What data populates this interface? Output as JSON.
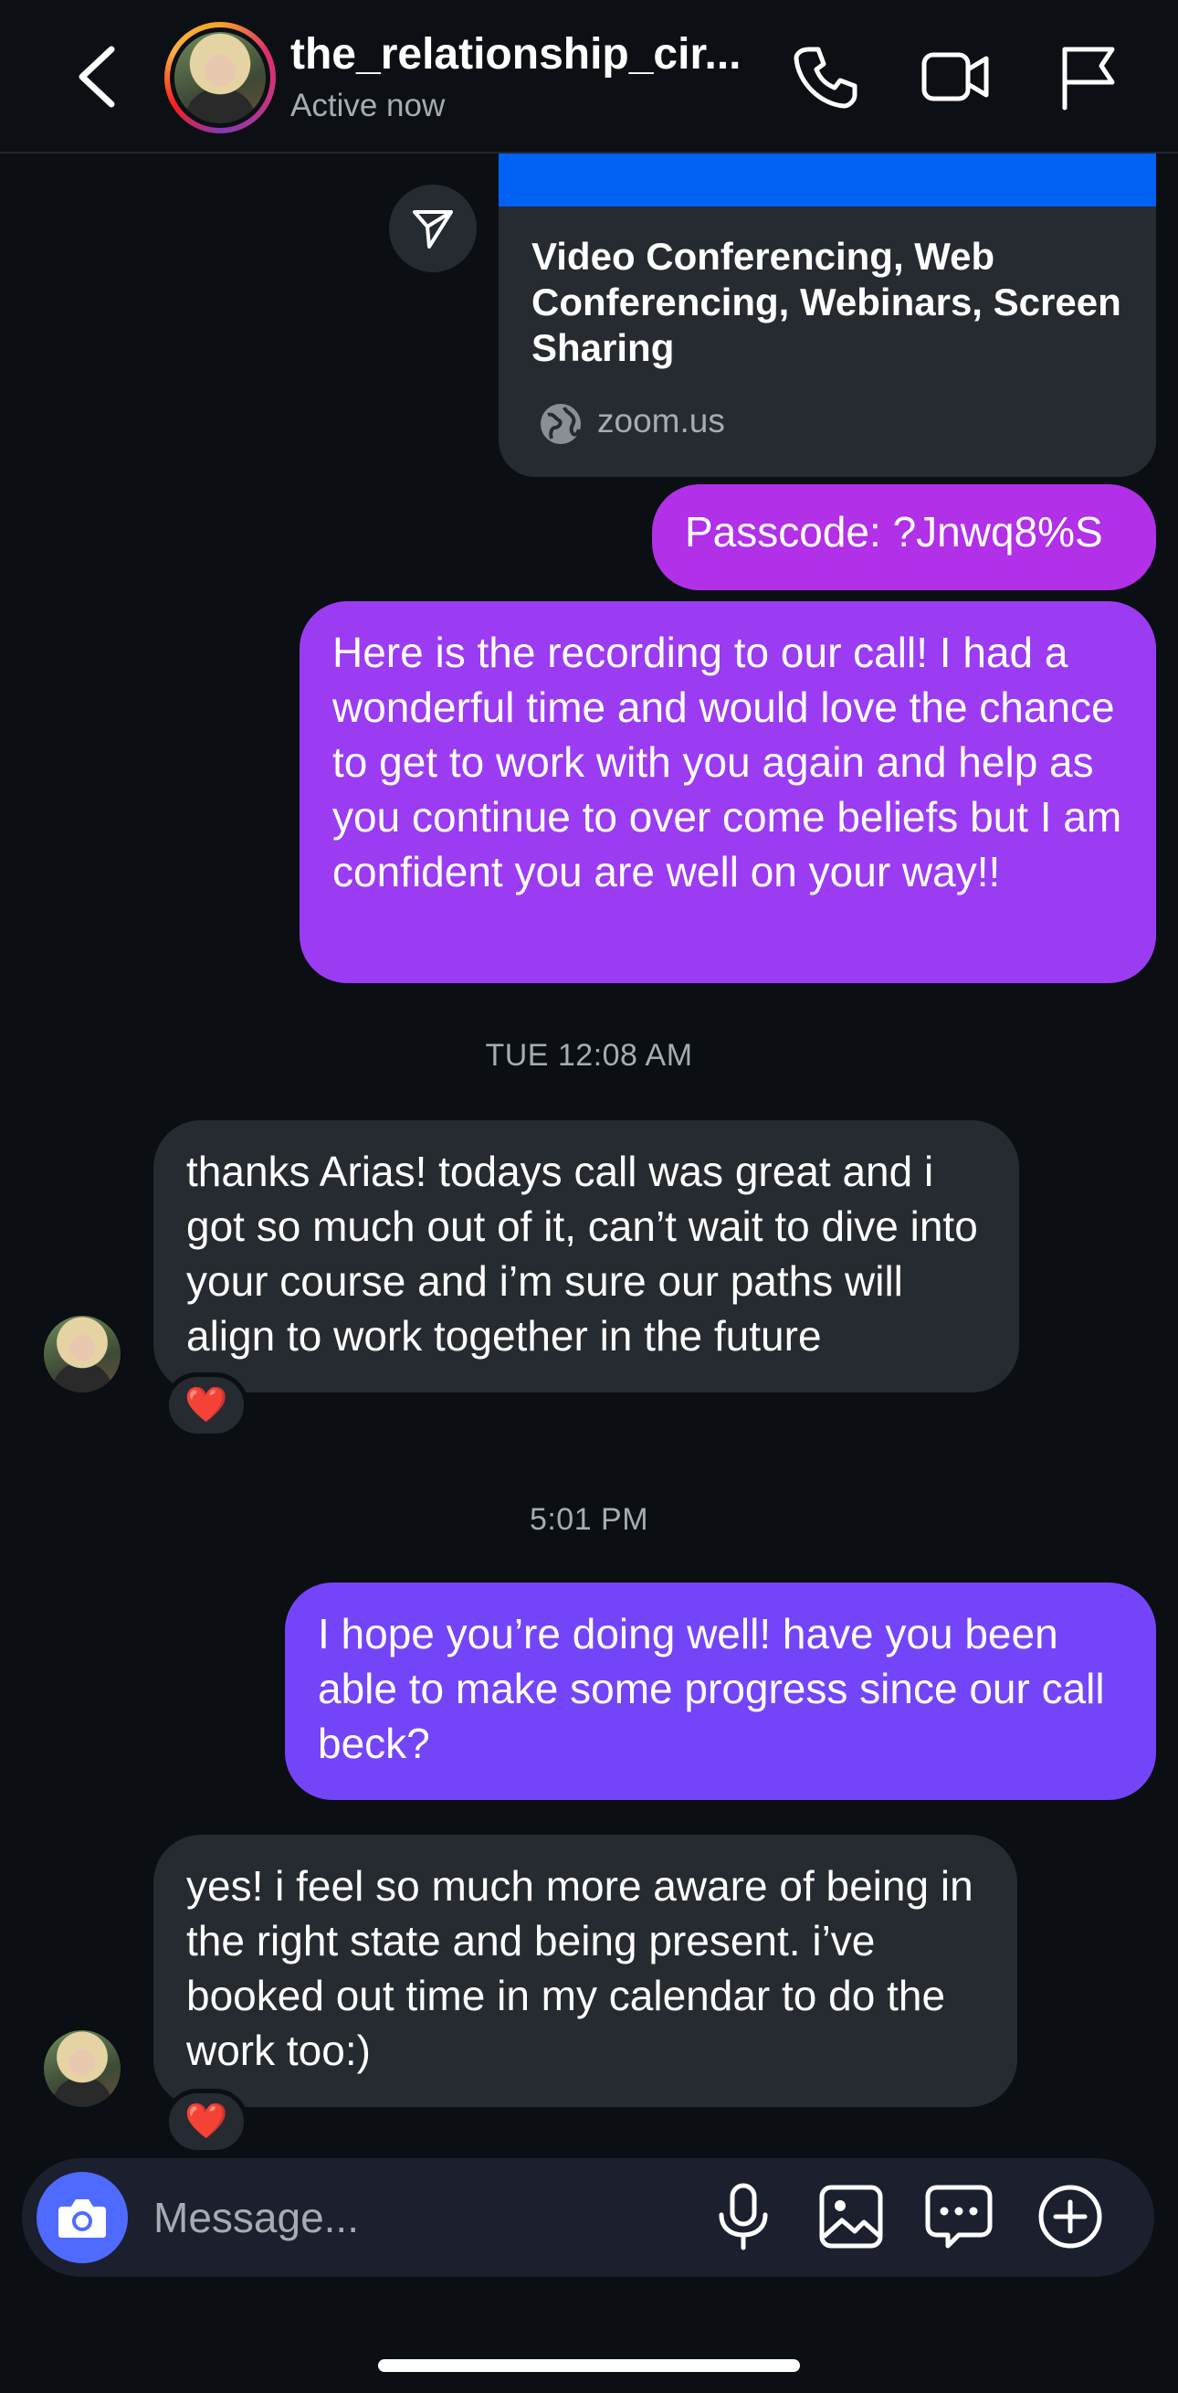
{
  "header": {
    "contact_name": "the_relationship_cir...",
    "status": "Active now",
    "icons": [
      "back-arrow-icon",
      "phone-icon",
      "video-camera-icon",
      "flag-icon"
    ]
  },
  "messages": {
    "link_card": {
      "title": "Video Conferencing, Web Conferencing, Webinars, Screen Sharing",
      "domain": "zoom.us"
    },
    "passcode": "Passcode: ?Jnwq8%S",
    "recording_note": "Here is the recording to our call! I had a wonderful time and would love the chance to get to work with you again and help as you continue to over come beliefs but I am confident you are well on your way!!",
    "timestamp_1": "TUE 12:08 AM",
    "reply_1": "thanks Arias! todays call was great and i got so much out of it, can’t wait to dive into your course and i’m sure our paths will align to work together in the future",
    "reaction_1": "❤️",
    "timestamp_2": "5:01 PM",
    "followup": "I hope you’re doing well!  have you been able to make some progress since our call beck?",
    "reply_2": "yes! i feel so much more aware of being in the right state and being present. i’ve booked out time in my calendar to do the work too:)",
    "reaction_2": "❤️"
  },
  "composer": {
    "placeholder": "Message...",
    "icons": [
      "camera-icon",
      "microphone-icon",
      "gallery-icon",
      "sticker-chat-icon",
      "plus-icon"
    ]
  },
  "colors": {
    "background": "#0b0e13",
    "incoming_bubble": "#262a31",
    "passcode_bubble": "#b130e8",
    "recording_bubble": "#9b3cf3",
    "followup_bubble": "#7445f8",
    "link_strip": "#0061f2",
    "camera_button": "#4f6bff"
  }
}
